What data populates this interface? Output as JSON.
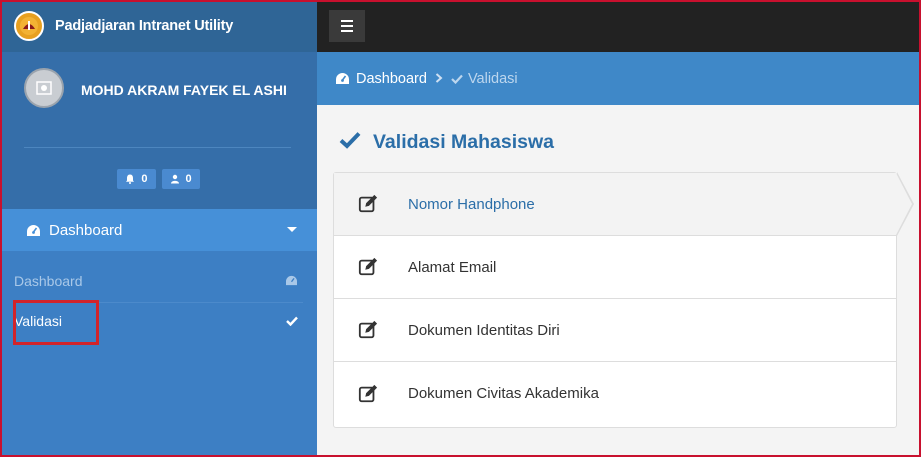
{
  "app": {
    "title": "Padjadjaran Intranet Utility"
  },
  "user": {
    "name": "MOHD AKRAM FAYEK EL ASHI",
    "notifications": "0",
    "users": "0"
  },
  "sidebar": {
    "main_item": "Dashboard",
    "submenu": [
      {
        "label": "Dashboard",
        "icon": "dashboard-icon"
      },
      {
        "label": "Validasi",
        "icon": "check-icon"
      }
    ]
  },
  "breadcrumb": {
    "home": "Dashboard",
    "current": "Validasi"
  },
  "page": {
    "title": "Validasi Mahasiswa"
  },
  "list": [
    {
      "label": "Nomor Handphone",
      "icon": "edit-icon",
      "active": true
    },
    {
      "label": "Alamat Email",
      "icon": "edit-icon"
    },
    {
      "label": "Dokumen Identitas Diri",
      "icon": "edit-icon"
    },
    {
      "label": "Dokumen Civitas Akademika",
      "icon": "edit-icon"
    }
  ],
  "colors": {
    "accent": "#3f88c8",
    "sidebar": "#3f80c6",
    "highlight": "#d2232a"
  }
}
